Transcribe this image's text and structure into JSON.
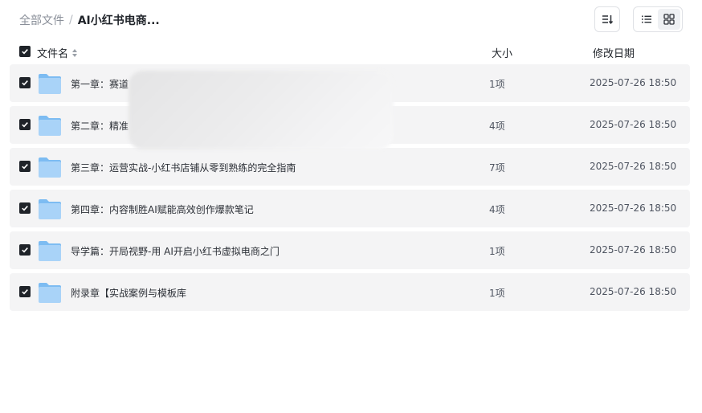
{
  "breadcrumb": {
    "root": "全部文件",
    "separator": "/",
    "current": "AI小红书电商..."
  },
  "toolbar": {
    "sort_icon": "sort-icon",
    "list_view_icon": "list-view-icon",
    "grid_view_icon": "grid-view-icon",
    "active_view": "grid"
  },
  "columns": {
    "name": "文件名",
    "size": "大小",
    "date": "修改日期"
  },
  "files": [
    {
      "name": "第一章：赛道",
      "size": "1项",
      "date": "2025-07-26 18:50",
      "checked": true
    },
    {
      "name": "第二章：精准",
      "size": "4项",
      "date": "2025-07-26 18:50",
      "checked": true
    },
    {
      "name": "第三章：运营实战-小红书店铺从零到熟练的完全指南",
      "size": "7项",
      "date": "2025-07-26 18:50",
      "checked": true
    },
    {
      "name": "第四章：内容制胜AI赋能高效创作爆款笔记",
      "size": "4项",
      "date": "2025-07-26 18:50",
      "checked": true
    },
    {
      "name": "导学篇：开局视野-用 AI开启小红书虚拟电商之门",
      "size": "1项",
      "date": "2025-07-26 18:50",
      "checked": true
    },
    {
      "name": "附录章【实战案例与模板库",
      "size": "1项",
      "date": "2025-07-26 18:50",
      "checked": true
    }
  ],
  "colors": {
    "row_bg": "#f4f4f5",
    "checkbox": "#1f2329",
    "folder_light": "#a9d3f8",
    "folder_dark": "#7dbcf2"
  }
}
